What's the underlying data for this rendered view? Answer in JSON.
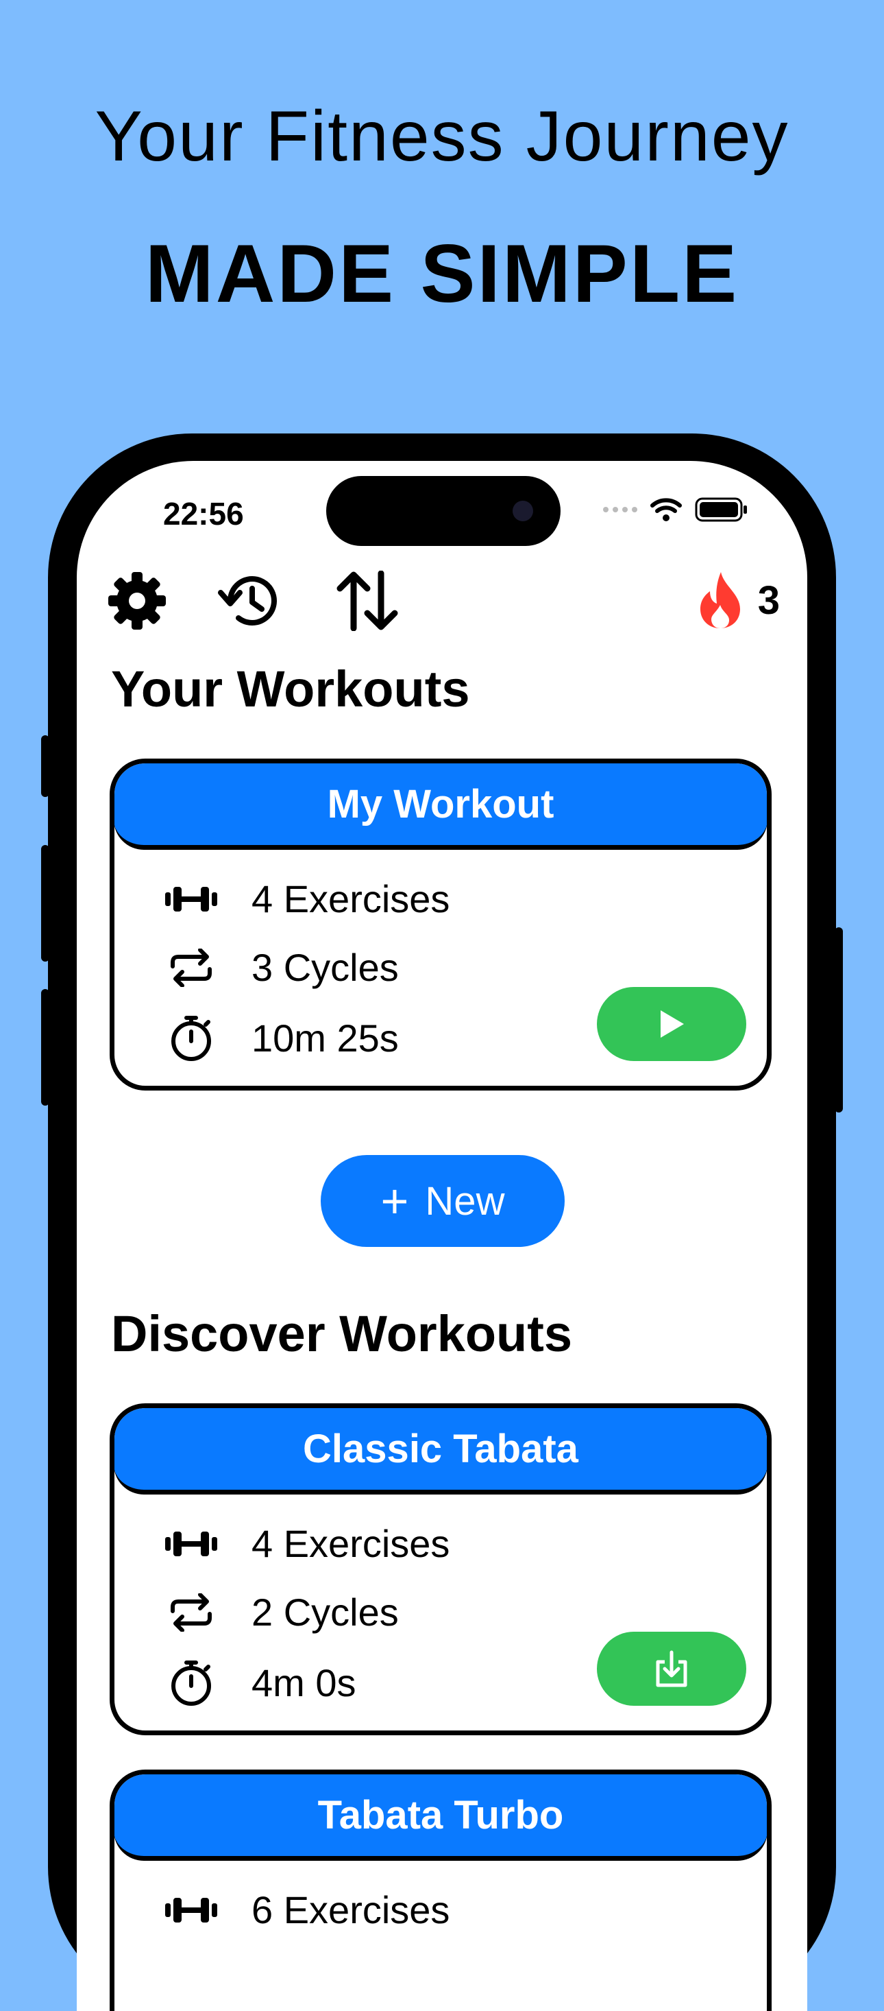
{
  "promo": {
    "subtitle": "Your Fitness Journey",
    "title": "MADE SIMPLE"
  },
  "status_bar": {
    "time": "22:56"
  },
  "toolbar": {
    "icons": [
      "gear-icon",
      "history-icon",
      "sort-icon"
    ],
    "streak_icon": "flame-icon",
    "streak_count": "3"
  },
  "your_workouts": {
    "title": "Your Workouts",
    "cards": [
      {
        "name": "My Workout",
        "exercises": "4 Exercises",
        "cycles": "3 Cycles",
        "duration": "10m 25s",
        "action": "play-icon"
      }
    ],
    "new_button": {
      "plus": "+",
      "label": "New"
    }
  },
  "discover_workouts": {
    "title": "Discover Workouts",
    "cards": [
      {
        "name": "Classic Tabata",
        "exercises": "4 Exercises",
        "cycles": "2 Cycles",
        "duration": "4m 0s",
        "action": "download-icon"
      },
      {
        "name": "Tabata Turbo",
        "exercises": "6 Exercises"
      }
    ]
  },
  "colors": {
    "background": "#7ebcfe",
    "accent": "#0a7aff",
    "go": "#33c457",
    "flame": "#ff3b30"
  }
}
